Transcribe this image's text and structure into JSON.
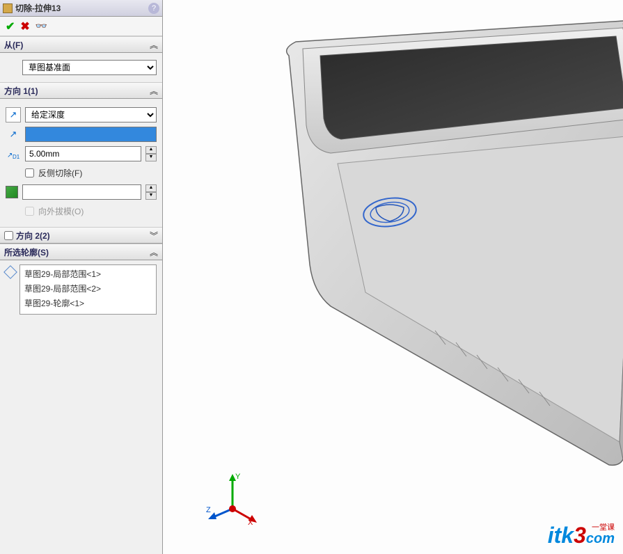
{
  "title": "切除-拉伸13",
  "sections": {
    "from": {
      "label": "从(F)",
      "start_condition": "草图基准面"
    },
    "direction1": {
      "label": "方向 1(1)",
      "end_condition": "给定深度",
      "depth_value": "",
      "distance": "5.00mm",
      "flip_side": "反侧切除(F)",
      "draft_value": "",
      "draft_outward": "向外拔模(O)"
    },
    "direction2": {
      "label": "方向 2(2)"
    },
    "contours": {
      "label": "所选轮廓(S)",
      "items": [
        "草图29-局部范围<1>",
        "草图29-局部范围<2>",
        "草图29-轮廓<1>"
      ]
    }
  },
  "triad": {
    "x": "X",
    "y": "Y",
    "z": "Z"
  },
  "watermark": {
    "brand_a": "itk",
    "brand_b": "3",
    "brand_c": "com",
    "sub": "一堂课"
  }
}
